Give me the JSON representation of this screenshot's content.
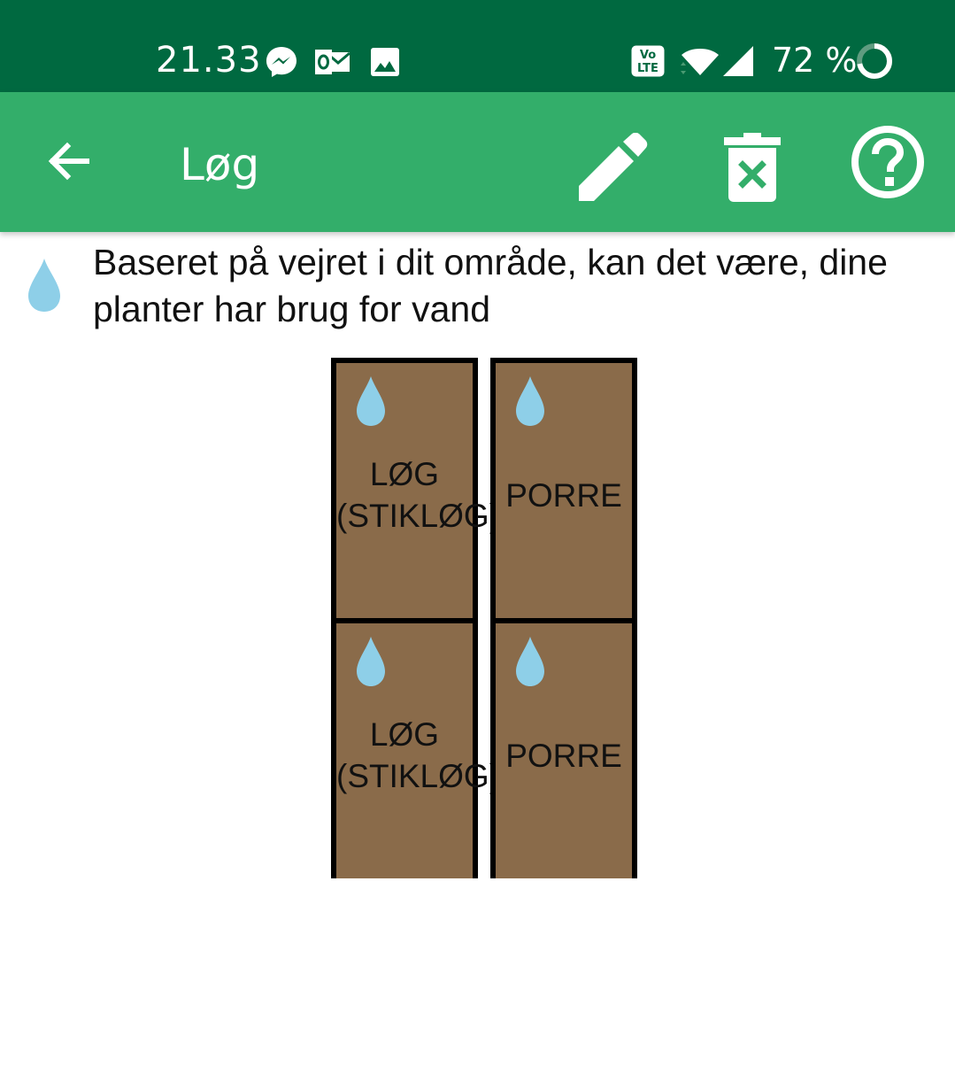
{
  "status_bar": {
    "time": "21.33",
    "notification_icons": [
      "messenger-icon",
      "outlook-icon",
      "gallery-icon"
    ],
    "system_icons": [
      "volte-icon",
      "wifi-icon",
      "cell-signal-icon"
    ],
    "battery_percent_text": "72 %",
    "battery_level": 0.72
  },
  "app_bar": {
    "title": "Løg",
    "actions": [
      "edit-icon",
      "delete-icon",
      "help-icon"
    ]
  },
  "notice": {
    "icon": "water-drop-icon",
    "text": "Baseret på vejret i dit område, kan det være, dine planter har brug for vand"
  },
  "bed": {
    "cells": [
      {
        "label": "LØG\n(STIKLØG)",
        "needs_water": true
      },
      {
        "label": "PORRE",
        "needs_water": true
      },
      {
        "label": "LØG\n(STIKLØG)",
        "needs_water": true
      },
      {
        "label": "PORRE",
        "needs_water": true
      }
    ]
  },
  "colors": {
    "status_bar": "#006940",
    "app_bar": "#33ae6a",
    "soil": "#8a6b4a",
    "water": "#8ecfe8"
  }
}
